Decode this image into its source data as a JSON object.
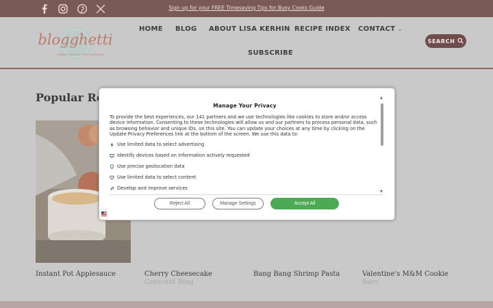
{
  "topbar": {
    "promo_text": "Sign up for your FREE Timesaving Tips for Busy Cooks Guide",
    "social_icons": [
      "facebook-icon",
      "instagram-icon",
      "pinterest-icon",
      "x-twitter-icon"
    ]
  },
  "header": {
    "logo_text": "blogghetti",
    "logo_tagline": "FAMILY RECIPES FOR EVERYONE",
    "nav": {
      "home": "HOME",
      "blog": "BLOG",
      "about": "ABOUT LISA KERHIN",
      "recipe_index": "RECIPE INDEX",
      "contact": "CONTACT",
      "subscribe": "SUBSCRIBE"
    },
    "search_label": "SEARCH"
  },
  "main": {
    "section_title": "Popular Rec",
    "cards": [
      {
        "title": "Instant Pot Applesauce",
        "subtitle": ""
      },
      {
        "title": "Cherry Cheesecake",
        "subtitle": "Crescent Ring"
      },
      {
        "title": "Bang Bang Shrimp Pasta",
        "subtitle": ""
      },
      {
        "title": "Valentine's M&M Cookie",
        "subtitle": "Bars"
      }
    ]
  },
  "privacy_modal": {
    "title": "Manage Your Privacy",
    "body": "To provide the best experiences, our 141 partners and we use technologies like cookies to store and/or access device information. Consenting to these technologies will allow us and our partners to process personal data, such as browsing behavior and unique IDs, on this site. You can update your choices at any time by clicking on the Update Privacy Preferences link at the bottom of the screen. We use this data to:",
    "purposes": [
      {
        "icon": "ad-icon",
        "label": "Use limited data to select advertising"
      },
      {
        "icon": "device-icon",
        "label": "Identify devices based on information actively requested"
      },
      {
        "icon": "location-icon",
        "label": "Use precise geolocation data"
      },
      {
        "icon": "heart-icon",
        "label": "Use limited data to select content"
      },
      {
        "icon": "rocket-icon",
        "label": "Develop and improve services"
      }
    ],
    "reject_label": "Reject All",
    "manage_label": "Manage Settings",
    "accept_label": "Accept All"
  },
  "colors": {
    "brand_dark": "#7a5a57",
    "accept_green": "#4caa55",
    "overlay_gray": "#c9c9c9"
  }
}
